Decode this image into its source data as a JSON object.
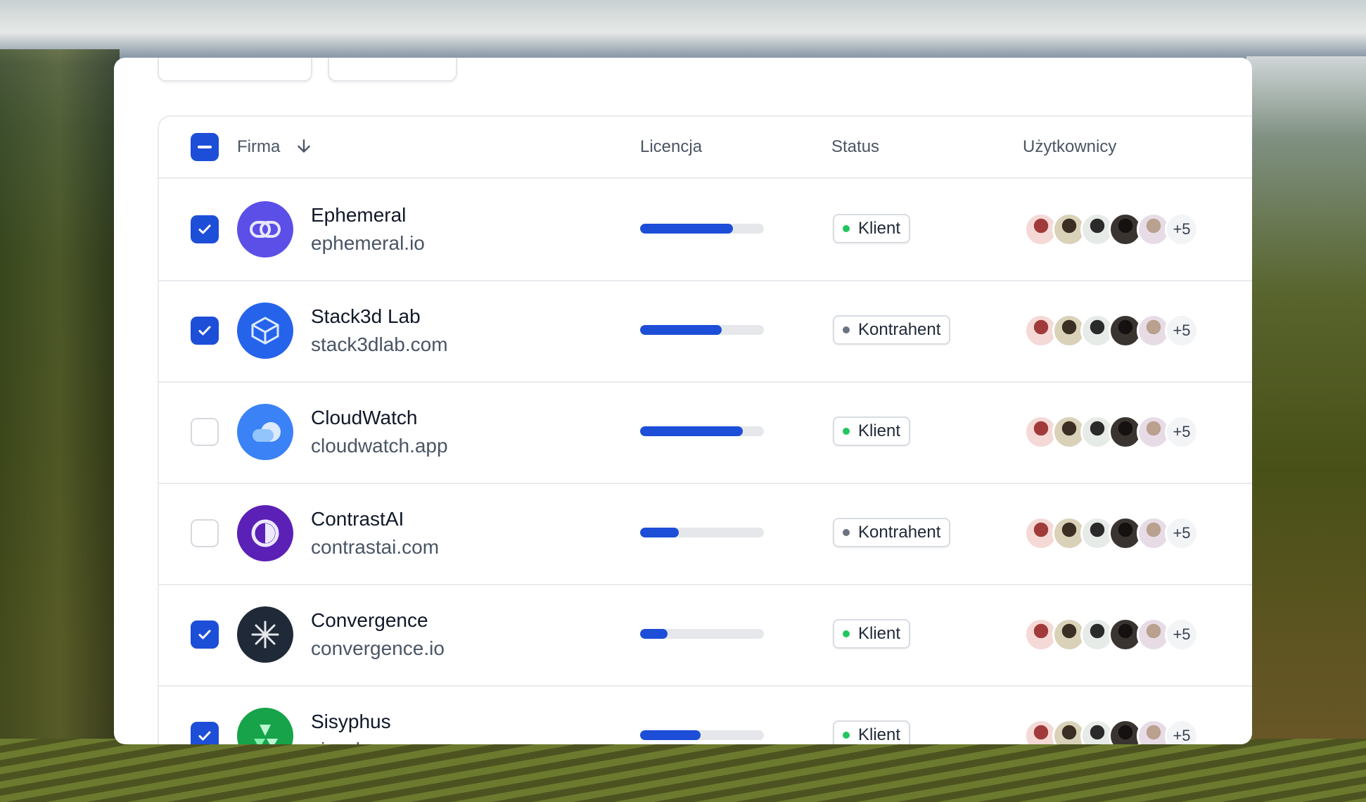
{
  "table": {
    "columns": {
      "company": "Firma",
      "license": "Licencja",
      "status": "Status",
      "users": "Użytkownicy"
    },
    "header_checkbox_state": "indeterminate",
    "sort_icon": "arrow-down-icon",
    "rows": [
      {
        "name": "Ephemeral",
        "domain": "ephemeral.io",
        "checked": true,
        "license_progress": 0.75,
        "status": "Klient",
        "status_color": "#22c55e",
        "logo": "chain-link-icon",
        "logo_color": "#5b4fe8",
        "users_more": "+5"
      },
      {
        "name": "Stack3d Lab",
        "domain": "stack3dlab.com",
        "checked": true,
        "license_progress": 0.66,
        "status": "Kontrahent",
        "status_color": "#6b7280",
        "logo": "cube-icon",
        "logo_color": "#2563eb",
        "users_more": "+5"
      },
      {
        "name": "CloudWatch",
        "domain": "cloudwatch.app",
        "checked": false,
        "license_progress": 0.83,
        "status": "Klient",
        "status_color": "#22c55e",
        "logo": "cloud-icon",
        "logo_color": "#3b82f6",
        "users_more": "+5"
      },
      {
        "name": "ContrastAI",
        "domain": "contrastai.com",
        "checked": false,
        "license_progress": 0.31,
        "status": "Kontrahent",
        "status_color": "#6b7280",
        "logo": "contrast-icon",
        "logo_color": "#5b21b6",
        "users_more": "+5"
      },
      {
        "name": "Convergence",
        "domain": "convergence.io",
        "checked": true,
        "license_progress": 0.22,
        "status": "Klient",
        "status_color": "#22c55e",
        "logo": "snowflake-icon",
        "logo_color": "#1f2937",
        "users_more": "+5"
      },
      {
        "name": "Sisyphus",
        "domain": "sisyphus.com",
        "checked": true,
        "license_progress": 0.49,
        "status": "Klient",
        "status_color": "#22c55e",
        "logo": "shape-icon",
        "logo_color": "#16a34a",
        "users_more": "+5"
      }
    ]
  }
}
